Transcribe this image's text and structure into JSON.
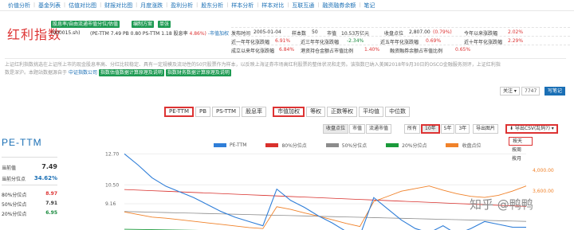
{
  "topnav": [
    "价值分析",
    "基金列表",
    "估值对比图",
    "财报对比图",
    "月度涨跌",
    "盈利分析",
    "股东分析",
    "样本分析",
    "样本对比",
    "互联互通",
    "融资融券余额",
    "笔记"
  ],
  "header": {
    "name": "红利指数",
    "code": "(000015.sh)",
    "badge_top": "股息率/自由流通市值分位/估值",
    "badge_b": "编制方案",
    "badge_c": "单张",
    "sub": {
      "pe_label": "(PE-TTM",
      "pe_val": "7.49",
      "pb_label": "PB",
      "pb_val": "0.80",
      "psttm_label": "PS-TTM",
      "psttm_val": "1.18",
      "dy_label": "股息率",
      "dy_val": "4.86%)",
      "mcap_link": "-市值加权"
    },
    "stats": {
      "publish_label": "发布时间",
      "publish": "2005-01-04",
      "samples_label": "样本数",
      "samples": "50",
      "mcap_label": "市值",
      "mcap": "10.53万亿元",
      "close_label": "收盘点位",
      "close": "2,807.00",
      "close_chg": "(0.79%)",
      "ytd_label": "今年以来涨跌幅",
      "ytd": "2.02%",
      "r3_label": "近一年年化涨跌幅",
      "r3": "6.91%",
      "r3b_label": "近三年年化涨跌幅",
      "r3b": "-2.34%",
      "r5_label": "近五年年化涨跌幅",
      "r5": "0.69%",
      "r10_label": "近十年年化涨跌幅",
      "r10": "2.29%",
      "since_label": "成立以来年化涨跌幅",
      "since": "6.84%",
      "hk_label": "港资持仓金额占市值比例",
      "hk": "1.40%",
      "margin_label": "融资融券余额占市值比例",
      "margin": "0.65%"
    }
  },
  "description": {
    "line1": "上证红利指数挑选在上证所上市的现金股息率高、分红比较稳定、具有一定规模及流动性的50只股票作为样本，以反映上海证券市场高红利股票的整体状况和走势。该指数已纳入美国2018年9月30日的OSCO金融服务测评，上证红利指",
    "line2_a": "数是深沪。本题站数据源自于",
    "line2_link": "中证指数公司",
    "pill1": "指数估值数据计算原理及说明",
    "pill2": "指数财务数据计算原理及说明"
  },
  "actions": {
    "follow": "关注 ▾",
    "count": "7747",
    "note": "写笔记"
  },
  "metric_tabs": [
    "PE-TTM",
    "PB",
    "PS-TTM",
    "股息率",
    "市值加权",
    "等权",
    "正数等权",
    "平均值",
    "中位数"
  ],
  "toolbar": {
    "group1": [
      "收盘点位",
      "市值",
      "流通市值"
    ],
    "group2": [
      "所有",
      "10年",
      "5年",
      "3年"
    ],
    "export_img": "导出图片",
    "export_csv": "⬇ 导出CSV(乱码?) ▾"
  },
  "dropdown": [
    "按天",
    "按周",
    "按月"
  ],
  "left_panel": {
    "title": "PE-TTM",
    "current_label": "当前值",
    "current": "7.49",
    "pct_label": "当前分位点",
    "pct": "34.62%",
    "p80_label": "80%分位点",
    "p80": "8.97",
    "p50_label": "50%分位点",
    "p50": "7.91",
    "p20_label": "20%分位点",
    "p20": "6.95"
  },
  "chart_data": {
    "type": "line",
    "legend": [
      "PE-TTM",
      "80%分位点",
      "50%分位点",
      "20%分位点",
      "收盘点位"
    ],
    "colors": {
      "pe": "#2f7ed8",
      "p80": "#d9302c",
      "p50": "#8c8c8c",
      "p20": "#1a9a3a",
      "close": "#f0822a"
    },
    "y_ticks_left": [
      "12.70",
      "10.50",
      "9.16"
    ],
    "y_ticks_right": [
      "4,000.00",
      "3,600.00"
    ],
    "pe": [
      12.7,
      11.9,
      11.0,
      10.4,
      10.0,
      9.6,
      9.1,
      8.6,
      8.2,
      7.9,
      7.6,
      10.2,
      9.4,
      8.9,
      8.3,
      7.8,
      7.2,
      6.9,
      9.6,
      8.8,
      8.0,
      7.4,
      7.1,
      7.6,
      7.0,
      7.4,
      7.9,
      7.7,
      7.5,
      7.49
    ],
    "p80": 8.97,
    "p50": 7.91,
    "p20": 6.95,
    "close": [
      3200,
      3150,
      3100,
      3080,
      3050,
      3020,
      2990,
      2960,
      2930,
      2900,
      2880,
      3300,
      3250,
      3180,
      3120,
      3050,
      2980,
      2920,
      3400,
      3500,
      3600,
      3650,
      3700,
      3620,
      3550,
      3500,
      3480,
      3520,
      3600,
      3700
    ]
  },
  "watermark": "知乎 @鸭鸭"
}
